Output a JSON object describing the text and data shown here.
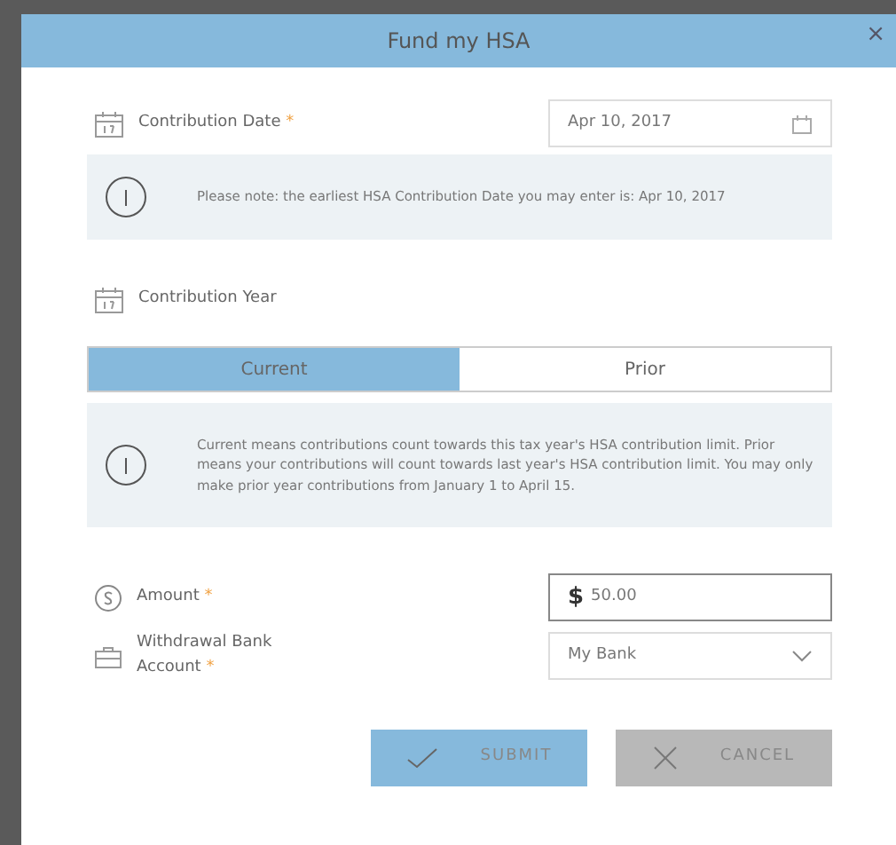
{
  "dialog": {
    "title": "Fund my HSA",
    "close": "×"
  },
  "contribution_date": {
    "label": "Contribution Date",
    "required_mark": "*",
    "value": "Apr 10, 2017"
  },
  "date_note": "Please note: the earliest HSA Contribution Date you may enter is: Apr 10, 2017",
  "contribution_year": {
    "label": "Contribution Year",
    "options": [
      {
        "label": "Current",
        "selected": true
      },
      {
        "label": "Prior",
        "selected": false
      }
    ]
  },
  "year_note": "Current means contributions count towards this tax year's HSA contribution limit. Prior means your contributions will count towards last year's HSA contribution limit. You may only make prior year contributions from January 1 to April 15.",
  "amount": {
    "label": "Amount",
    "required_mark": "*",
    "currency": "$",
    "value": "50.00"
  },
  "bank_account": {
    "label": "Withdrawal Bank Account",
    "required_mark": "*",
    "value": "My Bank"
  },
  "buttons": [
    {
      "label": "SUBMIT",
      "kind": "submit"
    },
    {
      "label": "CANCEL",
      "kind": "cancel"
    }
  ]
}
